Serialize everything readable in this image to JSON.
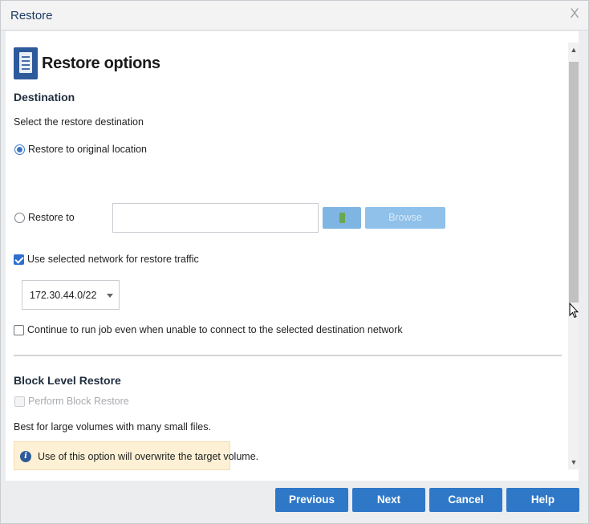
{
  "window": {
    "title": "Restore",
    "close_glyph": "X"
  },
  "header": {
    "title": "Restore options",
    "icon": "document-icon"
  },
  "destination": {
    "section_title": "Destination",
    "prompt": "Select the restore destination",
    "option_original": {
      "label": "Restore to original location",
      "selected": true
    },
    "option_restore_to": {
      "label": "Restore to",
      "selected": false,
      "path_value": ""
    },
    "browse_label": "Browse"
  },
  "network": {
    "use_selected_label": "Use selected network for restore traffic",
    "use_selected_checked": true,
    "selected_network": "172.30.44.0/22",
    "continue_label": "Continue to run job even when unable to connect to the selected destination network",
    "continue_checked": false
  },
  "block_level": {
    "section_title": "Block Level Restore",
    "perform_label": "Perform Block Restore",
    "perform_checked": false,
    "perform_enabled": false,
    "description": "Best for large volumes with many small files.",
    "warning": "Use of this option will overwrite the target volume.",
    "warning_icon": "info-icon"
  },
  "footer": {
    "previous": "Previous",
    "next": "Next",
    "cancel": "Cancel",
    "help": "Help"
  },
  "colors": {
    "primary_button": "#2f78c8",
    "title_text": "#1f3b63",
    "warning_bg": "#fdf0d4"
  }
}
